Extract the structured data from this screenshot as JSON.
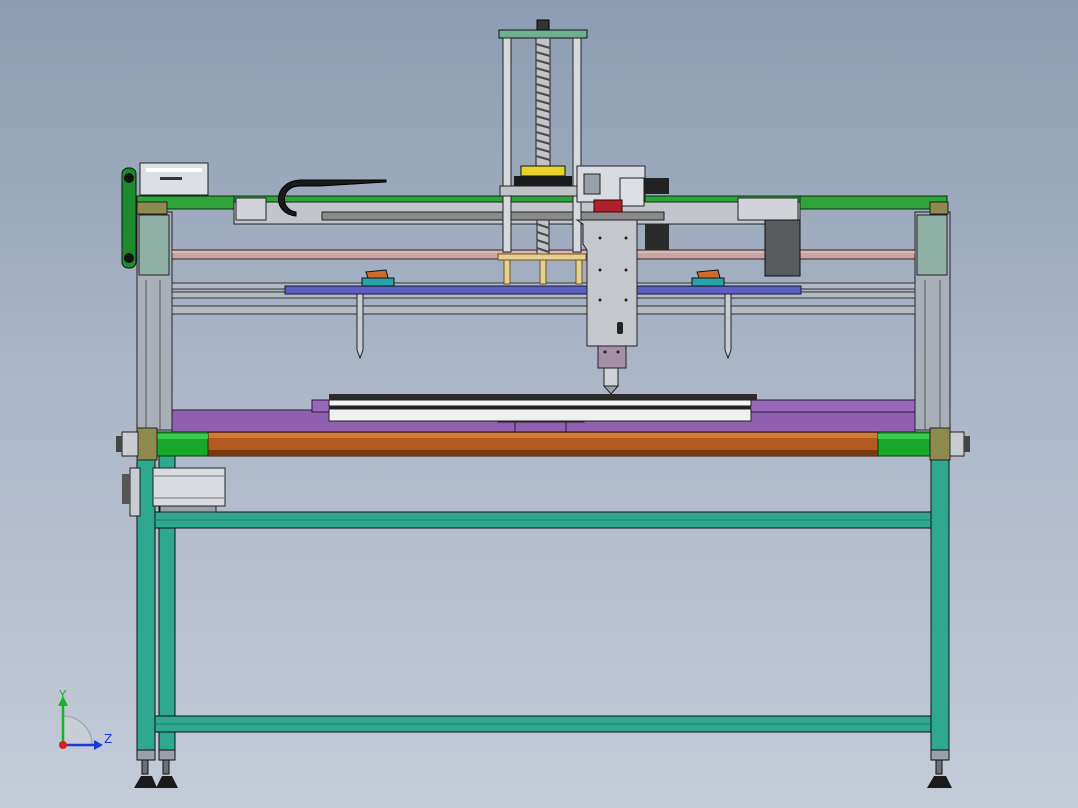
{
  "viewport": {
    "background_top": "#8c9cb2",
    "background_bottom": "#c4ccd8"
  },
  "model": {
    "frame_color": "#2fa890",
    "gantry_rail_color": "#2ea33a",
    "feed_roller_color": "#b45a1c",
    "work_table_color": "#8f5fb0",
    "guide_color": "#5a5fc0"
  },
  "triad": {
    "y_label": "Y",
    "z_label": "Z",
    "y_color": "#19b22a",
    "z_color": "#1f38d8",
    "x_color": "#d81f1f"
  }
}
